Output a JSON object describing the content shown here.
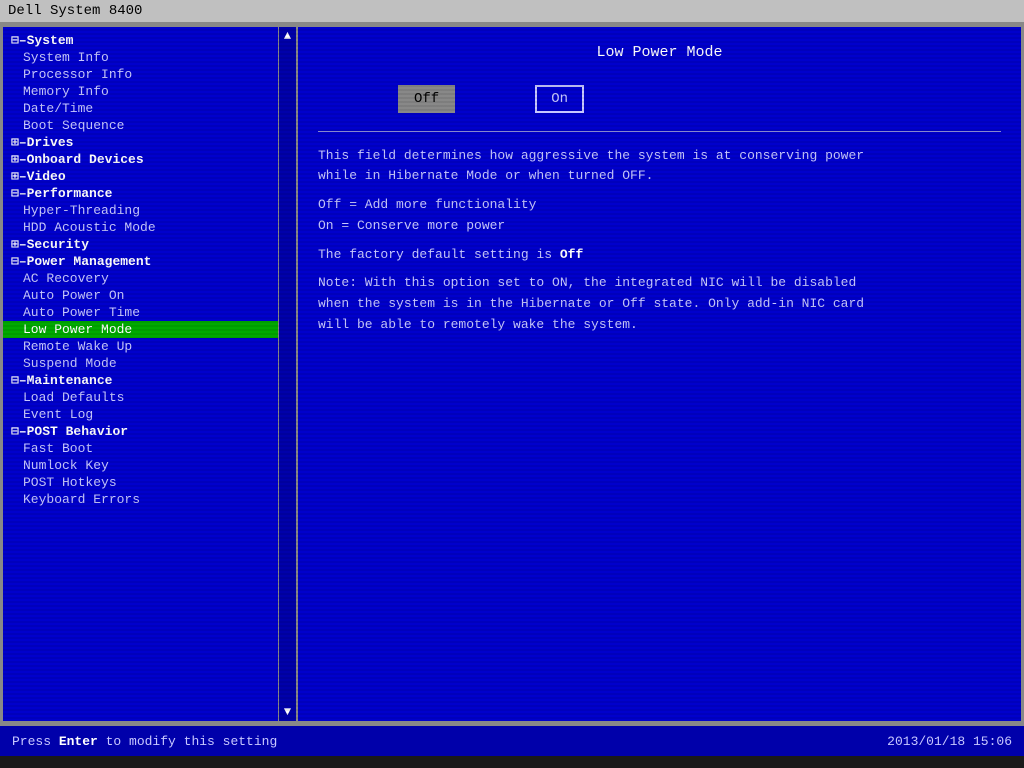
{
  "titlebar": {
    "text": "Dell System 8400"
  },
  "sidebar": {
    "scroll_up": "▲",
    "scroll_down": "▼",
    "items": [
      {
        "id": "system",
        "label": "⊟–System",
        "type": "category",
        "level": "top"
      },
      {
        "id": "system-info",
        "label": "System Info",
        "type": "sub",
        "level": "sub"
      },
      {
        "id": "processor-info",
        "label": "Processor Info",
        "type": "sub",
        "level": "sub"
      },
      {
        "id": "memory-info",
        "label": "Memory Info",
        "type": "sub",
        "level": "sub"
      },
      {
        "id": "date-time",
        "label": "Date/Time",
        "type": "sub",
        "level": "sub"
      },
      {
        "id": "boot-sequence",
        "label": "Boot Sequence",
        "type": "sub",
        "level": "sub"
      },
      {
        "id": "drives",
        "label": "⊞–Drives",
        "type": "category",
        "level": "top"
      },
      {
        "id": "onboard-devices",
        "label": "⊞–Onboard Devices",
        "type": "category",
        "level": "top"
      },
      {
        "id": "video",
        "label": "⊞–Video",
        "type": "category",
        "level": "top"
      },
      {
        "id": "performance",
        "label": "⊟–Performance",
        "type": "category",
        "level": "top"
      },
      {
        "id": "hyper-threading",
        "label": "Hyper-Threading",
        "type": "sub",
        "level": "sub"
      },
      {
        "id": "hdd-acoustic",
        "label": "HDD Acoustic Mode",
        "type": "sub",
        "level": "sub"
      },
      {
        "id": "security",
        "label": "⊞–Security",
        "type": "category",
        "level": "top"
      },
      {
        "id": "power-management",
        "label": "⊟–Power Management",
        "type": "category",
        "level": "top"
      },
      {
        "id": "ac-recovery",
        "label": "AC Recovery",
        "type": "sub",
        "level": "sub"
      },
      {
        "id": "auto-power-on",
        "label": "Auto Power On",
        "type": "sub",
        "level": "sub"
      },
      {
        "id": "auto-power-time",
        "label": "Auto Power Time",
        "type": "sub",
        "level": "sub"
      },
      {
        "id": "low-power-mode",
        "label": "Low Power Mode",
        "type": "sub active",
        "level": "sub"
      },
      {
        "id": "remote-wake-up",
        "label": "Remote Wake Up",
        "type": "sub",
        "level": "sub"
      },
      {
        "id": "suspend-mode",
        "label": "Suspend Mode",
        "type": "sub",
        "level": "sub"
      },
      {
        "id": "maintenance",
        "label": "⊟–Maintenance",
        "type": "category",
        "level": "top"
      },
      {
        "id": "load-defaults",
        "label": "Load Defaults",
        "type": "sub",
        "level": "sub"
      },
      {
        "id": "event-log",
        "label": "Event Log",
        "type": "sub",
        "level": "sub"
      },
      {
        "id": "post-behavior",
        "label": "⊟–POST Behavior",
        "type": "category",
        "level": "top"
      },
      {
        "id": "fast-boot",
        "label": "Fast Boot",
        "type": "sub",
        "level": "sub"
      },
      {
        "id": "numlock-key",
        "label": "Numlock Key",
        "type": "sub",
        "level": "sub"
      },
      {
        "id": "post-hotkeys",
        "label": "POST Hotkeys",
        "type": "sub",
        "level": "sub"
      },
      {
        "id": "keyboard-errors",
        "label": "Keyboard Errors",
        "type": "sub",
        "level": "sub"
      }
    ]
  },
  "content": {
    "title": "Low Power Mode",
    "option_off": "Off",
    "option_on": "On",
    "selected_option": "Off",
    "description_lines": [
      "This field determines how aggressive the system is at conserving power",
      "while in Hibernate Mode or when turned OFF.",
      "",
      "Off  = Add more functionality",
      "On   = Conserve more power",
      "",
      "The factory default setting is Off",
      "",
      "Note: With this option set to ON, the integrated NIC will be disabled",
      "when the system is in the Hibernate or Off state.  Only add-in NIC card",
      "will be able to remotely wake the system."
    ],
    "factory_default_bold": "Off"
  },
  "statusbar": {
    "left_prefix": "Press ",
    "enter_key": "Enter",
    "left_suffix": " to modify this setting",
    "right_text": "2013/01/18 15:06"
  }
}
